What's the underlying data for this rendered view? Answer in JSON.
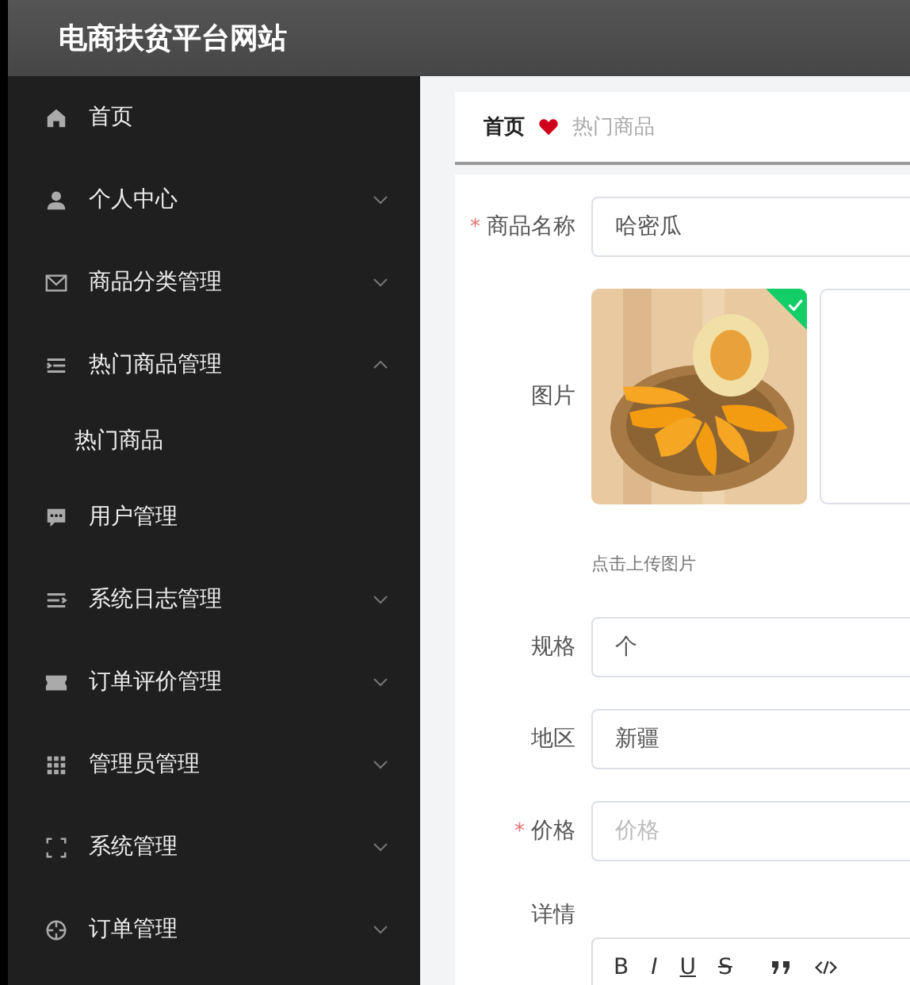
{
  "header": {
    "title": "电商扶贫平台网站"
  },
  "sidebar": {
    "items": [
      {
        "label": "首页",
        "has_arrow": false
      },
      {
        "label": "个人中心",
        "has_arrow": true,
        "expanded": false
      },
      {
        "label": "商品分类管理",
        "has_arrow": true,
        "expanded": false
      },
      {
        "label": "热门商品管理",
        "has_arrow": true,
        "expanded": true,
        "children": [
          {
            "label": "热门商品"
          }
        ]
      },
      {
        "label": "用户管理",
        "has_arrow": false
      },
      {
        "label": "系统日志管理",
        "has_arrow": true,
        "expanded": false
      },
      {
        "label": "订单评价管理",
        "has_arrow": true,
        "expanded": false
      },
      {
        "label": "管理员管理",
        "has_arrow": true,
        "expanded": false
      },
      {
        "label": "系统管理",
        "has_arrow": true,
        "expanded": false
      },
      {
        "label": "订单管理",
        "has_arrow": true,
        "expanded": false
      }
    ]
  },
  "breadcrumb": [
    {
      "label": "首页",
      "current": false
    },
    {
      "label": "热门商品",
      "current": true
    }
  ],
  "form": {
    "fields": [
      {
        "kind": "text",
        "label": "商品名称",
        "required_mark": "*",
        "value": "哈密瓜"
      },
      {
        "label": "图片",
        "uploaded": true,
        "hint": "点击上传图片"
      },
      {
        "kind": "text",
        "label": "规格",
        "value": "个"
      },
      {
        "kind": "text",
        "label": "地区",
        "value": "新疆"
      },
      {
        "kind": "text",
        "label": "价格",
        "required_mark": "*",
        "placeholder": "价格"
      },
      {
        "kind": "editor",
        "label": "详情",
        "tools": [
          {
            "kind": "text",
            "label": "B"
          },
          {
            "kind": "text",
            "label": "I"
          },
          {
            "kind": "text",
            "label": "U"
          },
          {
            "kind": "text",
            "label": "S"
          },
          {
            "kind": "quote"
          },
          {
            "kind": "code"
          }
        ]
      }
    ]
  }
}
